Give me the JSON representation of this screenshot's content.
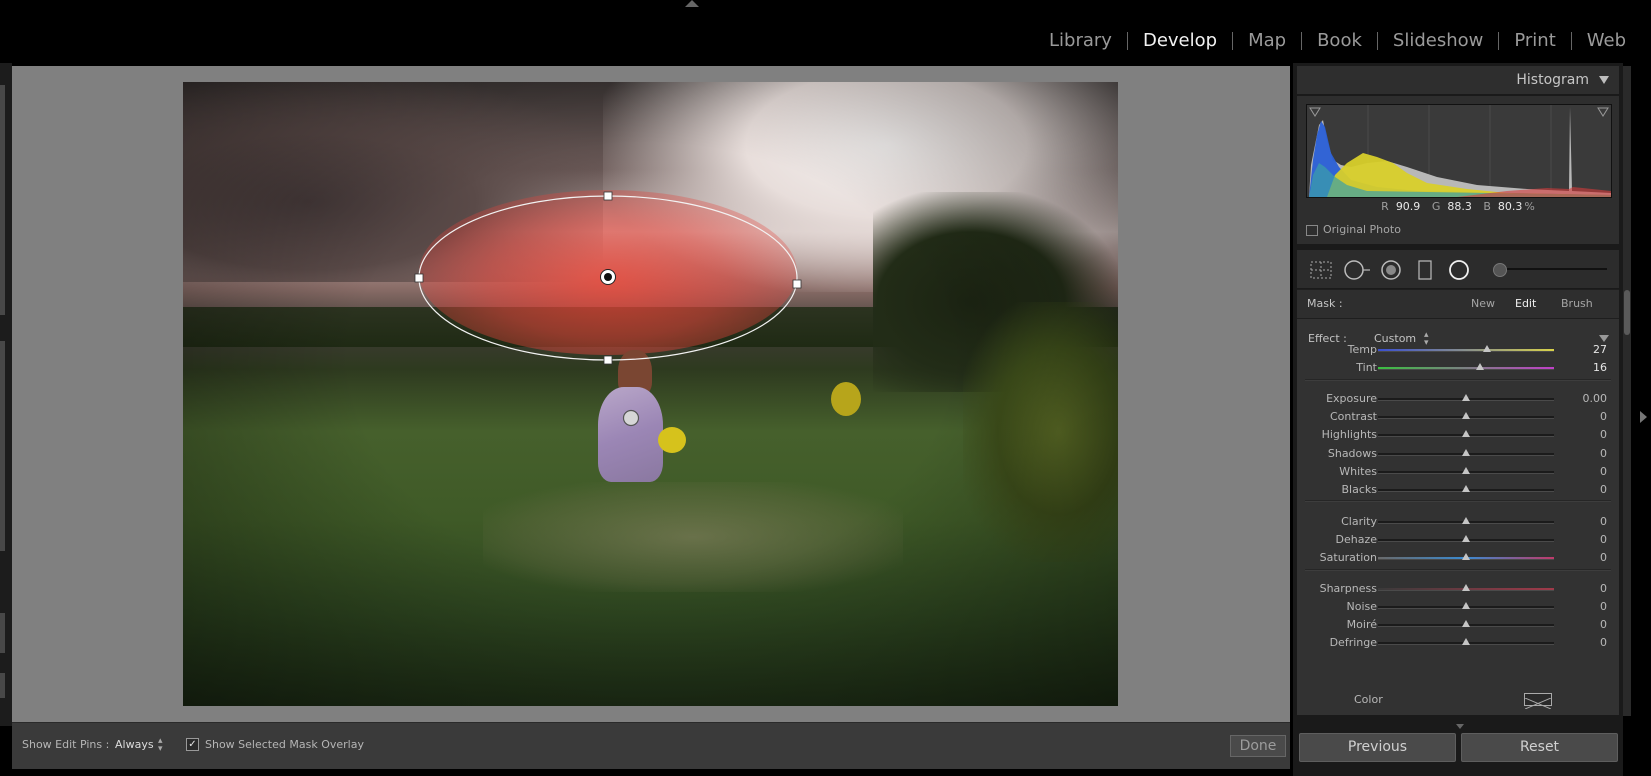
{
  "modules": [
    {
      "label": "Library",
      "active": false
    },
    {
      "label": "Develop",
      "active": true
    },
    {
      "label": "Map",
      "active": false
    },
    {
      "label": "Book",
      "active": false
    },
    {
      "label": "Slideshow",
      "active": false
    },
    {
      "label": "Print",
      "active": false
    },
    {
      "label": "Web",
      "active": false
    }
  ],
  "histogram": {
    "title": "Histogram",
    "r_label": "R",
    "r_value": "90.9",
    "g_label": "G",
    "g_value": "88.3",
    "b_label": "B",
    "b_value": "80.3",
    "percent": "%",
    "original_photo_label": "Original Photo"
  },
  "tools": [
    "crop-overlay-icon",
    "spot-removal-icon",
    "red-eye-icon",
    "graduated-filter-icon",
    "radial-filter-icon"
  ],
  "mask": {
    "label": "Mask :",
    "new_label": "New",
    "edit_label": "Edit",
    "brush_label": "Brush",
    "active": "Edit"
  },
  "effect": {
    "label": "Effect :",
    "value": "Custom"
  },
  "sliders": [
    {
      "name": "temp",
      "label": "Temp",
      "value": "27",
      "position": 0.62,
      "gradient": "temp"
    },
    {
      "name": "tint",
      "label": "Tint",
      "value": "16",
      "position": 0.58,
      "gradient": "tint"
    },
    {
      "name": "exposure",
      "label": "Exposure",
      "value": "0.00",
      "position": 0.5
    },
    {
      "name": "contrast",
      "label": "Contrast",
      "value": "0",
      "position": 0.5
    },
    {
      "name": "highlights",
      "label": "Highlights",
      "value": "0",
      "position": 0.5
    },
    {
      "name": "shadows",
      "label": "Shadows",
      "value": "0",
      "position": 0.5
    },
    {
      "name": "whites",
      "label": "Whites",
      "value": "0",
      "position": 0.5
    },
    {
      "name": "blacks",
      "label": "Blacks",
      "value": "0",
      "position": 0.5
    },
    {
      "name": "clarity",
      "label": "Clarity",
      "value": "0",
      "position": 0.5
    },
    {
      "name": "dehaze",
      "label": "Dehaze",
      "value": "0",
      "position": 0.5
    },
    {
      "name": "saturation",
      "label": "Saturation",
      "value": "0",
      "position": 0.5,
      "gradient": "saturation"
    },
    {
      "name": "sharpness",
      "label": "Sharpness",
      "value": "0",
      "position": 0.5,
      "gradient": "sharpness"
    },
    {
      "name": "noise",
      "label": "Noise",
      "value": "0",
      "position": 0.5
    },
    {
      "name": "moire",
      "label": "Moiré",
      "value": "0",
      "position": 0.5
    },
    {
      "name": "defringe",
      "label": "Defringe",
      "value": "0",
      "position": 0.5
    }
  ],
  "color_label": "Color",
  "toolbar": {
    "show_edit_pins_label": "Show Edit Pins :",
    "show_edit_pins_value": "Always",
    "show_overlay_label": "Show Selected Mask Overlay",
    "show_overlay_checked": true,
    "done_label": "Done"
  },
  "buttons": {
    "previous": "Previous",
    "reset": "Reset"
  },
  "colors": {
    "mask_overlay": "#ff4637",
    "panel_bg": "#323232",
    "workspace_bg": "#808080"
  }
}
